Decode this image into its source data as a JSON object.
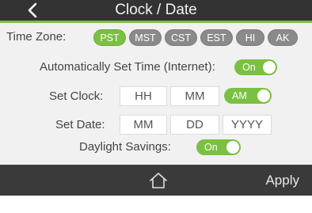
{
  "header": {
    "title": "Clock / Date"
  },
  "time_zone": {
    "label": "Time Zone:",
    "options": [
      "PST",
      "MST",
      "CST",
      "EST",
      "HI",
      "AK"
    ],
    "selected": "PST"
  },
  "auto_time": {
    "label": "Automatically Set Time (Internet):",
    "toggle": "On"
  },
  "set_clock": {
    "label": "Set Clock:",
    "hour": "HH",
    "minute": "MM",
    "ampm": "AM"
  },
  "set_date": {
    "label": "Set Date:",
    "month": "MM",
    "day": "DD",
    "year": "YYYY"
  },
  "daylight": {
    "label": "Daylight Savings:",
    "toggle": "On"
  },
  "footer": {
    "apply": "Apply"
  },
  "colors": {
    "accent": "#7bc043",
    "header_bg": "#333333",
    "footer_bg": "#3a3a3a",
    "pill_inactive": "#8a8a8a",
    "body_bg": "#f1f1f1"
  }
}
